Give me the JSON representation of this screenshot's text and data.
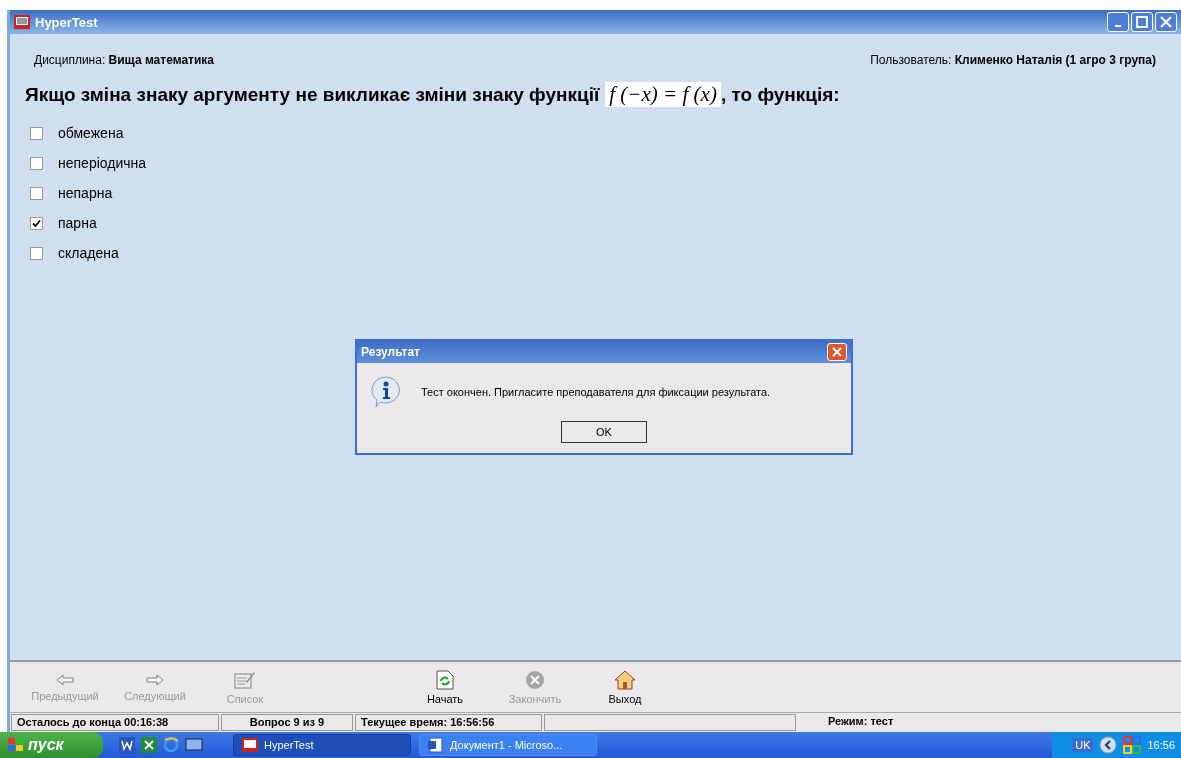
{
  "window": {
    "title": "HyperTest"
  },
  "header": {
    "discipline_label": "Дисциплина:",
    "discipline": "Вища математика",
    "user_label": "Пользователь:",
    "user": "Клименко Наталія (1 агро 3 група)"
  },
  "question": {
    "before": "Якщо зміна знаку аргументу не викликає зміни знаку функції",
    "formula": "f (−x) = f (x)",
    "after": ", то функція:"
  },
  "options": [
    {
      "label": "обмежена",
      "checked": false
    },
    {
      "label": "неперіодична",
      "checked": false
    },
    {
      "label": "непарна",
      "checked": false
    },
    {
      "label": "парна",
      "checked": true
    },
    {
      "label": "складена",
      "checked": false
    }
  ],
  "dialog": {
    "title": "Результат",
    "message": "Тест окончен. Пригласите преподавателя для фиксации результата.",
    "button": "OK"
  },
  "toolbar": [
    {
      "kind": "prev",
      "label": "Предыдущий",
      "disabled": true
    },
    {
      "kind": "next",
      "label": "Следующий",
      "disabled": true
    },
    {
      "kind": "list",
      "label": "Список",
      "disabled": true
    },
    {
      "kind": "start",
      "label": "Начать",
      "disabled": false
    },
    {
      "kind": "finish",
      "label": "Закончить",
      "disabled": true
    },
    {
      "kind": "exit",
      "label": "Выход",
      "disabled": false
    }
  ],
  "status_bar": [
    "Осталось до конца 00:16:38",
    "Вопрос 9 из 9",
    "Текущее время: 16:56:56",
    "Режим: тест"
  ],
  "taskbar": {
    "start": "пуск",
    "tasks": [
      {
        "label": "HyperTest",
        "selected": true
      },
      {
        "label": "Документ1 - Microso...",
        "selected": false
      }
    ],
    "language": "UK",
    "clock": "16:56"
  }
}
